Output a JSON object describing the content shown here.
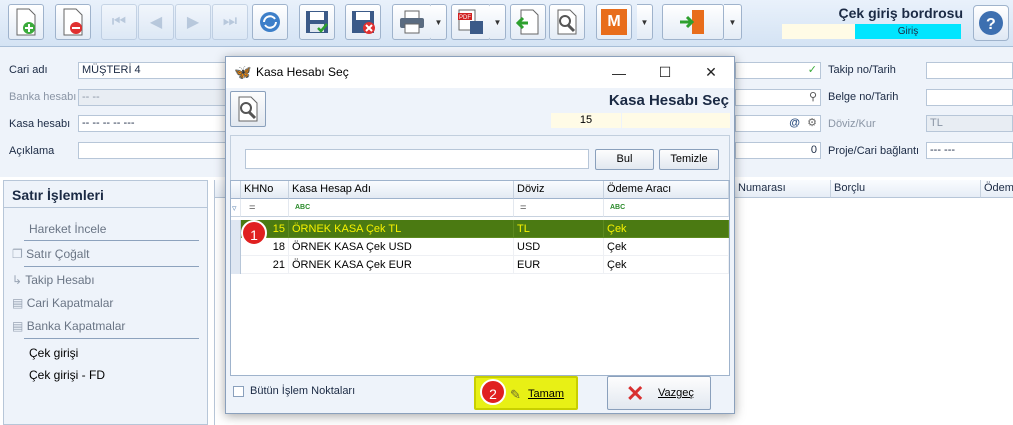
{
  "toolbar": {
    "window_title": "Çek giriş bordrosu",
    "mode": "Giriş",
    "icons": [
      "new-doc-icon",
      "delete-doc-icon",
      "first-icon",
      "prev-icon",
      "next-icon",
      "last-icon",
      "refresh-icon",
      "save-icon",
      "save-cancel-icon",
      "print-icon",
      "pdf-save-icon",
      "import-icon",
      "tools-icon",
      "m-icon",
      "exit-icon",
      "help-icon"
    ]
  },
  "form": {
    "cari_adi_label": "Cari adı",
    "cari_adi_value": "MÜŞTERİ 4",
    "banka_hesabi_label": "Banka hesabı",
    "banka_hesabi_value": "-- --",
    "kasa_hesabi_label": "Kasa hesabı",
    "kasa_hesabi_value": "-- -- -- -- ---",
    "aciklama_label": "Açıklama",
    "takip_label": "Takip no/Tarih",
    "belge_label": "Belge no/Tarih",
    "doviz_label": "Döviz/Kur",
    "doviz_value": "TL",
    "proje_label": "Proje/Cari bağlantı",
    "proje_value": "--- ---",
    "amount_value": "0"
  },
  "left_panel": {
    "title": "Satır İşlemleri",
    "items": [
      {
        "label": "Hareket İncele"
      },
      {
        "label": "Satır Çoğalt"
      },
      {
        "label": "Takip Hesabı"
      },
      {
        "label": "Cari Kapatmalar"
      },
      {
        "label": "Banka Kapatmalar"
      },
      {
        "label": "Çek girişi"
      },
      {
        "label": "Çek girişi - FD"
      }
    ]
  },
  "right_grid": {
    "columns": [
      "Numarası",
      "Borçlu",
      "Ödeme"
    ]
  },
  "dialog": {
    "title": "Kasa Hesabı Seç",
    "heading": "Kasa Hesabı Seç",
    "count": "15",
    "search_value": "",
    "bul_label": "Bul",
    "temizle_label": "Temizle",
    "columns": [
      "KHNo",
      "Kasa Hesap Adı",
      "Döviz",
      "Ödeme Aracı"
    ],
    "filter_symbols": [
      "=",
      "ABC",
      "=",
      "ABC"
    ],
    "rows": [
      {
        "no": "15",
        "name": "ÖRNEK KASA Çek TL",
        "doviz": "TL",
        "odeme": "Çek",
        "selected": true
      },
      {
        "no": "18",
        "name": "ÖRNEK KASA Çek USD",
        "doviz": "USD",
        "odeme": "Çek",
        "selected": false
      },
      {
        "no": "21",
        "name": "ÖRNEK KASA Çek EUR",
        "doviz": "EUR",
        "odeme": "Çek",
        "selected": false
      }
    ],
    "checkbox_label": "Bütün İşlem Noktaları",
    "ok_label": "Tamam",
    "cancel_label": "Vazgeç",
    "badges": [
      "1",
      "2"
    ],
    "selected_row_color": "#4b7a12",
    "selected_text_color": "#f7f200"
  }
}
